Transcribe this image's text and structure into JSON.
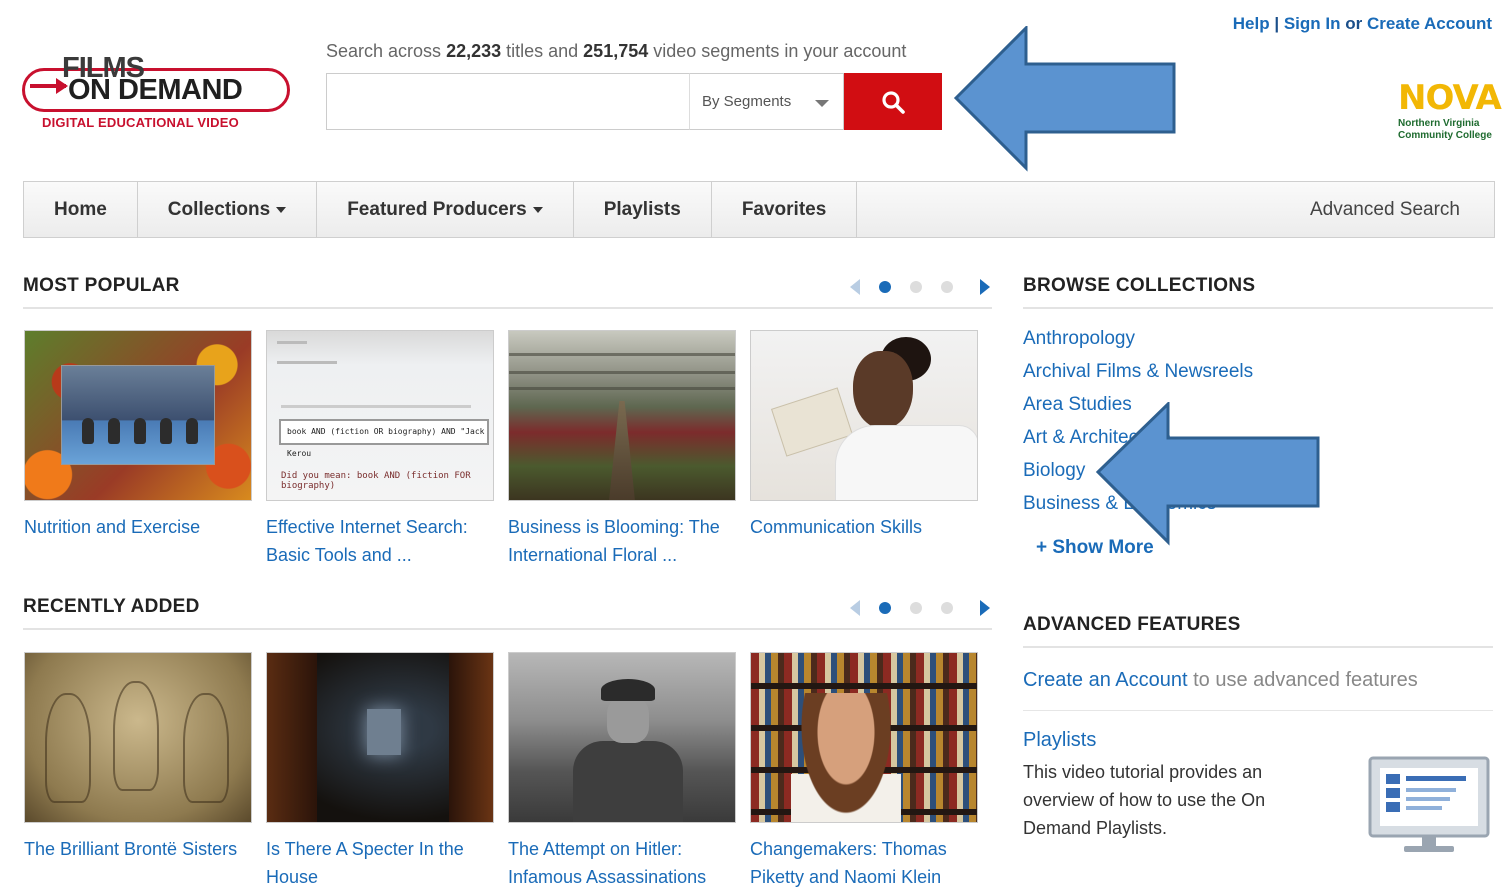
{
  "logo": {
    "line1": "FILMS",
    "line2": "ON DEMAND",
    "tagline": "DIGITAL EDUCATIONAL VIDEO"
  },
  "search": {
    "caption_prefix": "Search across ",
    "titles_count": "22,233",
    "caption_mid": " titles and ",
    "segments_count": "251,754",
    "caption_suffix": " video segments in your account",
    "input_value": "",
    "scope_selected": "By Segments",
    "button_icon": "search-icon",
    "button_color": "#d10d12"
  },
  "top_links": {
    "help": "Help",
    "separator": "|",
    "sign_in": "Sign In",
    "or": "or",
    "create_account": "Create Account"
  },
  "institution": {
    "name": "NOVA",
    "line1": "Northern Virginia",
    "line2": "Community College"
  },
  "nav": {
    "items": [
      {
        "label": "Home",
        "dropdown": false
      },
      {
        "label": "Collections",
        "dropdown": true
      },
      {
        "label": "Featured Producers",
        "dropdown": true
      },
      {
        "label": "Playlists",
        "dropdown": false
      },
      {
        "label": "Favorites",
        "dropdown": false
      }
    ],
    "advanced": "Advanced Search"
  },
  "most_popular": {
    "title": "MOST POPULAR",
    "pager": {
      "pages": 4,
      "current": 1
    },
    "cards": [
      {
        "title": "Nutrition and Exercise"
      },
      {
        "title": "Effective Internet Search: Basic Tools and ...",
        "thumb_text": "book AND (fiction OR biography) AND \"Jack Kerou",
        "thumb_dym": "Did you mean: book AND (fiction FOR biography)"
      },
      {
        "title": "Business is Blooming: The International Floral ..."
      },
      {
        "title": "Communication Skills"
      }
    ]
  },
  "recently_added": {
    "title": "RECENTLY ADDED",
    "pager": {
      "pages": 4,
      "current": 1
    },
    "cards": [
      {
        "title": "The Brilliant Brontë Sisters"
      },
      {
        "title": "Is There A Specter In the House"
      },
      {
        "title": "The Attempt on Hitler: Infamous Assassinations"
      },
      {
        "title": "Changemakers: Thomas Piketty and Naomi Klein"
      }
    ]
  },
  "browse": {
    "title": "BROWSE COLLECTIONS",
    "items": [
      "Anthropology",
      "Archival Films & Newsreels",
      "Area Studies",
      "Art & Architecture",
      "Biology",
      "Business & Economics"
    ],
    "show_more": "+ Show More"
  },
  "advanced_features": {
    "title": "ADVANCED FEATURES",
    "create_link": "Create an Account",
    "create_rest": " to use advanced features",
    "playlists_title": "Playlists",
    "playlists_desc": "This video tutorial provides an overview of how to use the On Demand Playlists.",
    "icon": "monitor-icon"
  },
  "annotations": {
    "arrow_color": "#5b93d0",
    "arrow_outline": "#2e5f8f"
  }
}
